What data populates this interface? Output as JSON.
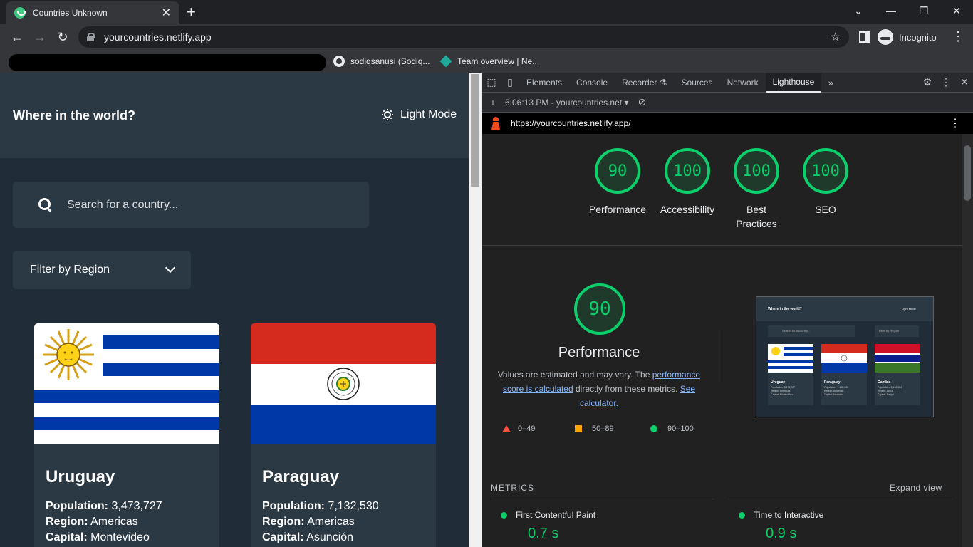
{
  "browser": {
    "tab_title": "Countries Unknown",
    "url": "yourcountries.netlify.app",
    "profile_label": "Incognito",
    "bookmarks": [
      "sodiqsanusi (Sodiq...",
      "Team overview | Ne..."
    ]
  },
  "site": {
    "title": "Where in the world?",
    "mode_label": "Light Mode",
    "search_placeholder": "Search for a country...",
    "filter_label": "Filter by Region",
    "countries": [
      {
        "name": "Uruguay",
        "population": "3,473,727",
        "region": "Americas",
        "capital": "Montevideo"
      },
      {
        "name": "Paraguay",
        "population": "7,132,530",
        "region": "Americas",
        "capital": "Asunción"
      }
    ],
    "labels": {
      "population": "Population:",
      "region": "Region:",
      "capital": "Capital:"
    }
  },
  "devtools": {
    "tabs": [
      "Elements",
      "Console",
      "Recorder",
      "Sources",
      "Network",
      "Lighthouse"
    ],
    "active_tab": "Lighthouse",
    "report_label": "6:06:13 PM - yourcountries.net",
    "report_url": "https://yourcountries.netlify.app/"
  },
  "lighthouse": {
    "scores": [
      {
        "label": "Performance",
        "value": 90
      },
      {
        "label": "Accessibility",
        "value": 100
      },
      {
        "label": "Best Practices",
        "value": 100
      },
      {
        "label": "SEO",
        "value": 100
      }
    ],
    "performance": {
      "score": 90,
      "title": "Performance",
      "desc_pre": "Values are estimated and may vary. The ",
      "desc_link1": "performance score is calculated",
      "desc_mid": " directly from these metrics. ",
      "desc_link2": "See calculator."
    },
    "legend": [
      "0–49",
      "50–89",
      "90–100"
    ],
    "legend_colors": {
      "fail": "#ff4e42",
      "average": "#ffa400",
      "pass": "#0cce6b"
    },
    "metrics_header": "METRICS",
    "expand_label": "Expand view",
    "metrics": [
      {
        "name": "First Contentful Paint",
        "value": "0.7 s"
      },
      {
        "name": "Time to Interactive",
        "value": "0.9 s"
      }
    ],
    "thumbnail": {
      "title": "Where in the world?",
      "mode": "Light Mode",
      "search": "Search for a country...",
      "filter": "Filter by Region",
      "cards": [
        {
          "name": "Uruguay",
          "info": [
            "Population: 3,473,727",
            "Region: Americas",
            "Capital: Montevideo"
          ]
        },
        {
          "name": "Paraguay",
          "info": [
            "Population: 7,132,530",
            "Region: Americas",
            "Capital: Asunción"
          ]
        },
        {
          "name": "Gambia",
          "info": [
            "Population: 2,416,664",
            "Region: Africa",
            "Capital: Banjul"
          ]
        }
      ]
    }
  },
  "colors": {
    "accent_pass": "#0cce6b",
    "site_bg": "#202c37",
    "site_elements": "#2b3945"
  }
}
